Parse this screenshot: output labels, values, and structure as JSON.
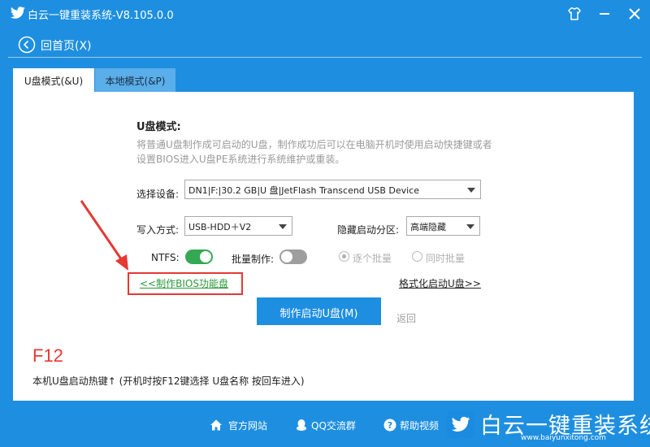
{
  "window": {
    "title": "白云一键重装系统-V8.105.0.0"
  },
  "nav": {
    "home_label": "回首页(X)"
  },
  "tabs": [
    {
      "label": "U盘模式(&U)",
      "active": true
    },
    {
      "label": "本地模式(&P)",
      "active": false
    }
  ],
  "usb_mode": {
    "title": "U盘模式:",
    "description": "将普通U盘制作成可启动的U盘，制作成功后可以在电脑开机时使用启动快捷键或者设置BIOS进入U盘PE系统进行系统维护或重装。",
    "device_label": "选择设备:",
    "device_value": "DN1|F:|30.2 GB|U 盘|JetFlash Transcend USB Device",
    "write_label": "写入方式:",
    "write_value": "USB-HDD＋V2",
    "hidden_label": "隐藏启动分区:",
    "hidden_value": "高端隐藏",
    "ntfs_label": "NTFS:",
    "ntfs_on": true,
    "batch_label": "批量制作:",
    "batch_on": false,
    "radio_one": "逐个批量",
    "radio_all": "同时批量",
    "bios_link": "<<制作BIOS功能盘",
    "format_link": "格式化启动U盘>>",
    "make_button": "制作启动U盘(M)",
    "return_link": "返回"
  },
  "hotkey": {
    "key": "F12",
    "text": "本机U盘启动热键↑ (开机时按F12键选择 U盘名称 按回车进入)"
  },
  "footer": {
    "website": "官方网站",
    "qq": "QQ交流群",
    "help": "帮助视频"
  },
  "brand": {
    "name": "白云一键重装系统",
    "url": "www.baiyunxitong.com"
  },
  "colors": {
    "primary": "#1e8fe0",
    "toggle_on": "#35a853",
    "highlight": "#e53935"
  }
}
